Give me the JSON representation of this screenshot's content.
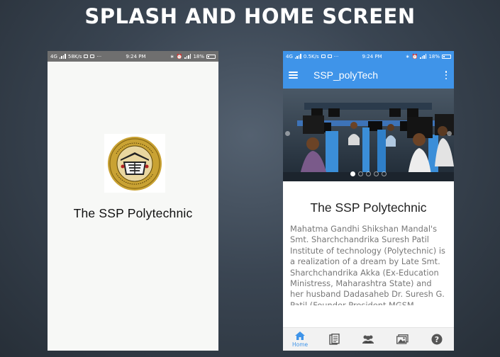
{
  "page_title": "SPLASH AND HOME SCREEN",
  "splash": {
    "status": {
      "network": "4G",
      "speed": "58K/s",
      "more": "···",
      "time": "9:24 PM",
      "battery": "18%"
    },
    "college_name": "The SSP Polytechnic"
  },
  "home": {
    "status": {
      "network": "4G",
      "speed": "0.5K/s",
      "more": "···",
      "time": "9:24 PM",
      "battery": "18%"
    },
    "app_title": "SSP_polyTech",
    "carousel": {
      "slide_count": 5,
      "active_index": 0
    },
    "heading": "The SSP Polytechnic",
    "description": "Mahatma Gandhi Shikshan Mandal's Smt. Sharchchandrika Suresh Patil Institute of technology (Polytechnic) is a realization of a dream by Late Smt. Sharchchandrika Akka (Ex-Education Ministress, Maharashtra State) and her husband Dadasaheb Dr. Suresh G. Patil (Founder President MGSM, Chopda). It's a premier",
    "bottom_nav": [
      {
        "label": "Home",
        "icon": "home-icon",
        "active": true
      },
      {
        "label": "",
        "icon": "document-icon",
        "active": false
      },
      {
        "label": "",
        "icon": "people-icon",
        "active": false
      },
      {
        "label": "",
        "icon": "gallery-icon",
        "active": false
      },
      {
        "label": "",
        "icon": "help-icon",
        "active": false
      }
    ]
  },
  "colors": {
    "accent": "#3f94e9",
    "nav_icon": "#555555",
    "splash_status": "#6f6f6f",
    "logo_gold": "#c9a233"
  }
}
